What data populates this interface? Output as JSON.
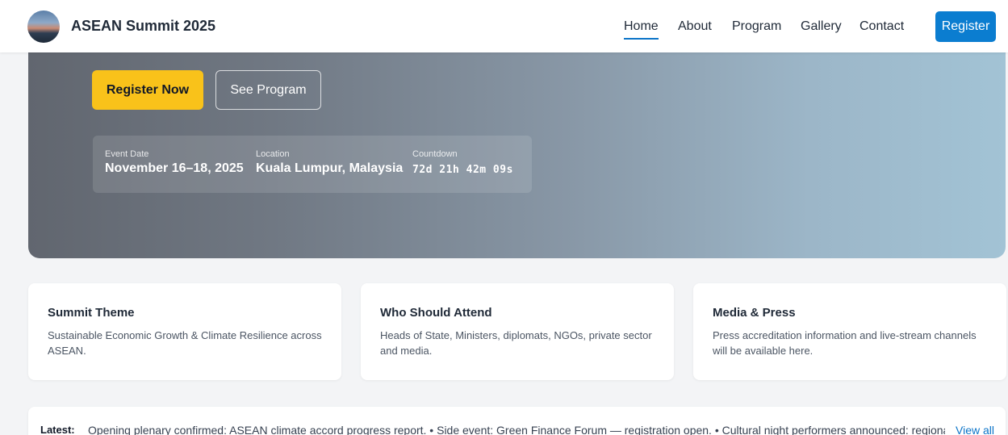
{
  "header": {
    "brand": "ASEAN Summit 2025",
    "logo_icon": "event-logo-icon",
    "nav": [
      {
        "label": "Home",
        "active": true
      },
      {
        "label": "About",
        "active": false
      },
      {
        "label": "Program",
        "active": false
      },
      {
        "label": "Gallery",
        "active": false
      },
      {
        "label": "Contact",
        "active": false
      }
    ],
    "register_label": "Register"
  },
  "hero": {
    "primary_button": "Register Now",
    "secondary_button": "See Program",
    "info": {
      "date_label": "Event Date",
      "date_value": "November 16–18, 2025",
      "location_label": "Location",
      "location_value": "Kuala Lumpur, Malaysia",
      "countdown_label": "Countdown",
      "countdown_value": "72d 21h 42m 09s"
    }
  },
  "cards": [
    {
      "title": "Summit Theme",
      "text": "Sustainable Economic Growth & Climate Resilience across ASEAN."
    },
    {
      "title": "Who Should Attend",
      "text": "Heads of State, Ministers, diplomats, NGOs, private sector and media."
    },
    {
      "title": "Media & Press",
      "text": "Press accreditation information and live-stream channels will be available here."
    }
  ],
  "latest": {
    "label": "Latest:",
    "text": "Opening plenary confirmed: ASEAN climate accord progress report. • Side event: Green Finance Forum — registration open. • Cultural night performers announced: regional",
    "view_all": "View all"
  },
  "colors": {
    "accent": "#0b7dd0",
    "primary_button": "#f9c21a"
  }
}
